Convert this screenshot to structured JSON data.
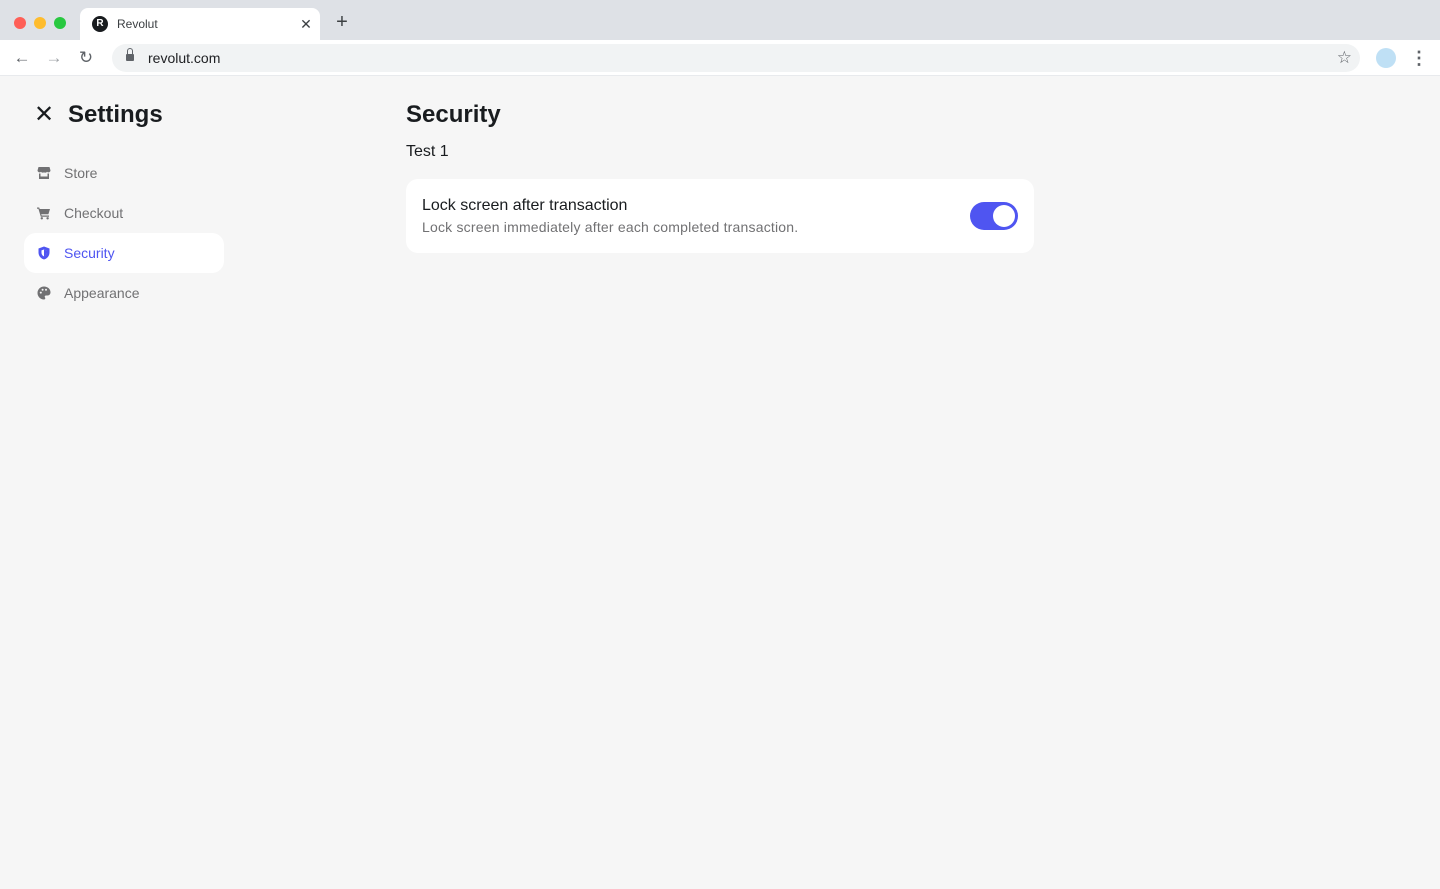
{
  "browser": {
    "tab_title": "Revolut",
    "favicon_letter": "R",
    "tab_close": "✕",
    "new_tab": "+",
    "url": "revolut.com",
    "back": "←",
    "forward": "→",
    "reload": "↻",
    "star": "☆",
    "menu": "⋮"
  },
  "settings": {
    "close_glyph": "✕",
    "title": "Settings",
    "nav": [
      {
        "label": "Store",
        "icon": "store-icon"
      },
      {
        "label": "Checkout",
        "icon": "cart-icon"
      },
      {
        "label": "Security",
        "icon": "shield-icon",
        "active": true
      },
      {
        "label": "Appearance",
        "icon": "palette-icon"
      }
    ]
  },
  "main": {
    "title": "Security",
    "subtitle": "Test 1",
    "setting": {
      "title": "Lock screen after transaction",
      "description": "Lock screen immediately after each completed transaction.",
      "enabled": true
    }
  },
  "colors": {
    "accent": "#4f55f1",
    "background": "#f6f6f6",
    "muted_text": "#717173"
  }
}
